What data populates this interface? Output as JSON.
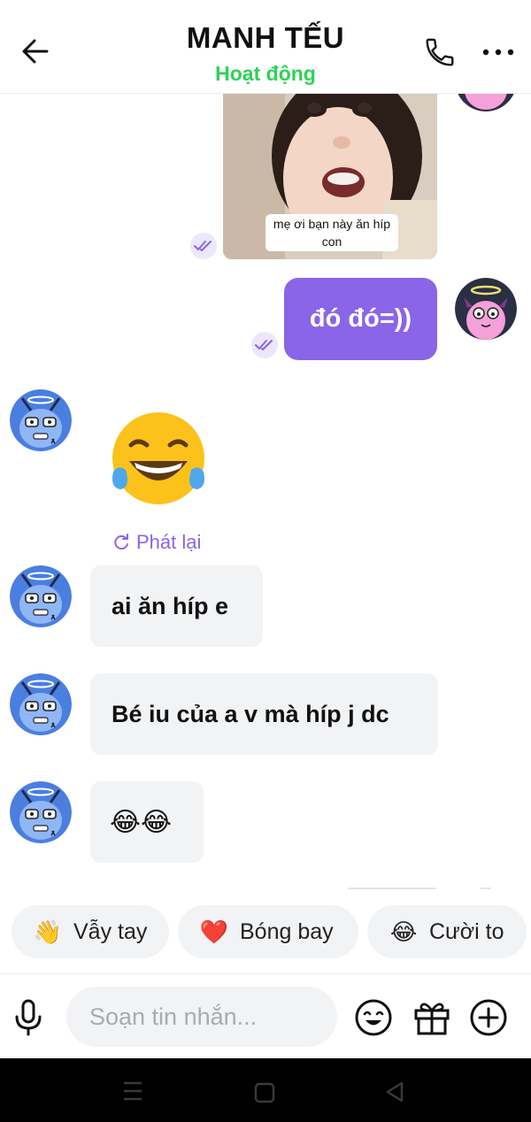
{
  "header": {
    "title": "MANH TẾU",
    "status": "Hoạt động",
    "status_color": "#2ed158",
    "back_icon": "arrow-left-icon",
    "call_icon": "phone-icon",
    "more_icon": "more-dots-icon"
  },
  "messages": {
    "photo_caption": "mẹ ơi bạn này ăn híp con",
    "outgoing_text": "đó đó=))",
    "replay_label": "Phát lại",
    "incoming": [
      {
        "text": "ai ăn híp e"
      },
      {
        "text": "Bé iu của a v mà híp j dc"
      },
      {
        "text": "😂😂"
      }
    ],
    "seen_icon": "double-check-icon",
    "accent_color": "#8a65e8"
  },
  "quick_replies": [
    {
      "icon": "👋",
      "label": "Vẫy tay"
    },
    {
      "icon": "❤️",
      "label": "Bóng bay"
    },
    {
      "icon": "😂",
      "label": "Cười to"
    }
  ],
  "composer": {
    "placeholder": "Soạn tin nhắn..."
  }
}
